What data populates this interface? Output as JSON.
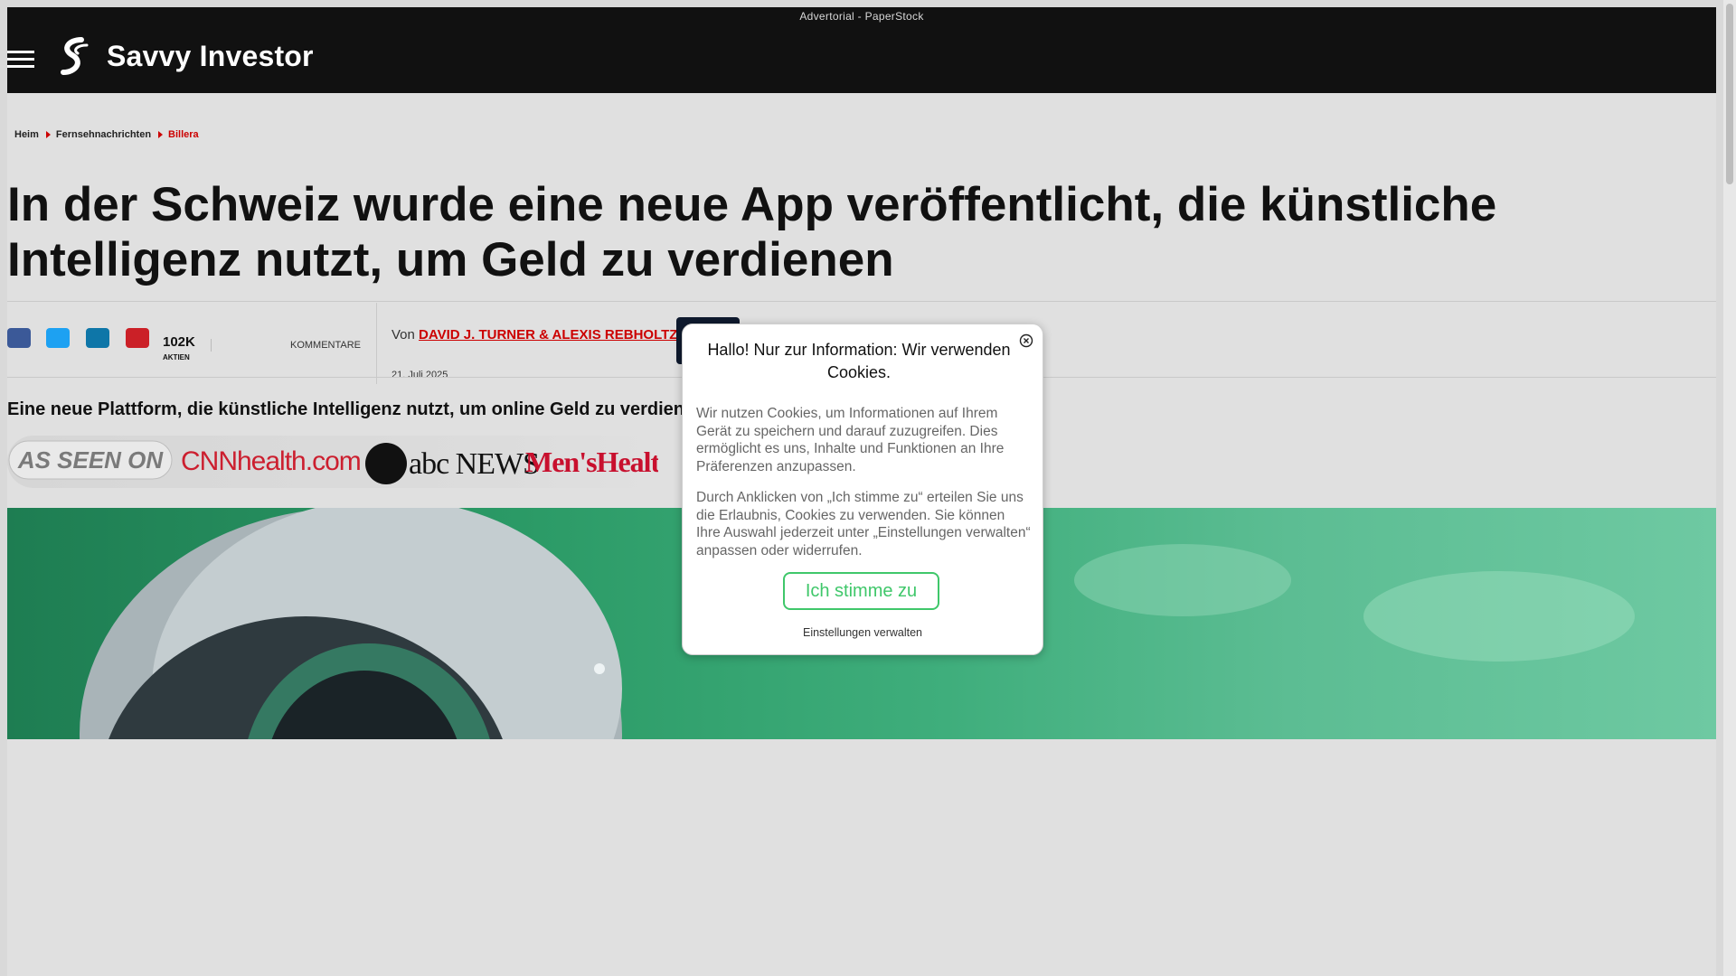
{
  "ad_label": "Advertorial - PaperStock",
  "brand": {
    "name": "Savvy Investor"
  },
  "breadcrumb": {
    "items": [
      "Heim",
      "Fernsehnachrichten",
      "Billera"
    ]
  },
  "article": {
    "headline": "In der Schweiz wurde eine neue App veröffentlicht, die künstliche Intelligenz nutzt, um Geld zu verdienen",
    "share_count": "102K",
    "share_label": "AKTIEN",
    "comments_label": "KOMMENTARE",
    "byline_prefix": "Von",
    "authors": "DAVID J. TURNER & ALEXIS REBHOLTZ",
    "date": "21. Juli 2025",
    "subhead": "Eine neue Plattform, die künstliche Intelligenz nutzt, um online Geld zu verdienen",
    "as_seen_on": {
      "label": "AS SEEN ON",
      "outlets": [
        "CNNhealth.com",
        "abc NEWS",
        "Men'sHealth"
      ]
    }
  },
  "share_buttons": [
    {
      "name": "facebook",
      "color": "#3b5998"
    },
    {
      "name": "twitter",
      "color": "#1da1f2"
    },
    {
      "name": "linkedin",
      "color": "#0e76a8"
    },
    {
      "name": "pinterest",
      "color": "#cb2027"
    }
  ],
  "cookie_modal": {
    "title": "Hallo! Nur zur Information: Wir verwenden Cookies.",
    "paragraph1": "Wir nutzen Cookies, um Informationen auf Ihrem Gerät zu speichern und darauf zuzugreifen. Dies ermöglicht es uns, Inhalte und Funktionen an Ihre Präferenzen anzupassen.",
    "paragraph2": "Durch Anklicken von „Ich stimme zu“ erteilen Sie uns die Erlaubnis, Cookies zu verwenden. Sie können Ihre Auswahl jederzeit unter „Einstellungen verwalten“ anpassen oder widerrufen.",
    "agree_label": "Ich stimme zu",
    "manage_label": "Einstellungen verwalten",
    "accent_color": "#3fc76a"
  }
}
